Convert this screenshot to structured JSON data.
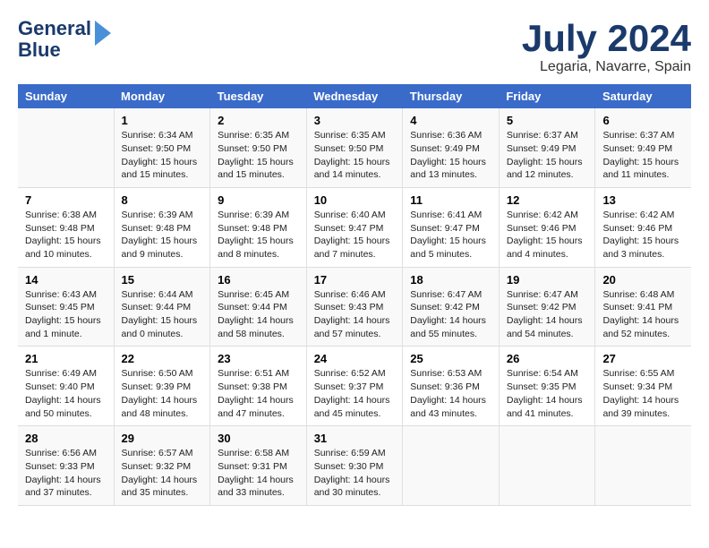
{
  "header": {
    "logo_line1": "General",
    "logo_line2": "Blue",
    "title": "July 2024",
    "subtitle": "Legaria, Navarre, Spain"
  },
  "days_of_week": [
    "Sunday",
    "Monday",
    "Tuesday",
    "Wednesday",
    "Thursday",
    "Friday",
    "Saturday"
  ],
  "weeks": [
    [
      {
        "day": "",
        "content": ""
      },
      {
        "day": "1",
        "content": "Sunrise: 6:34 AM\nSunset: 9:50 PM\nDaylight: 15 hours\nand 15 minutes."
      },
      {
        "day": "2",
        "content": "Sunrise: 6:35 AM\nSunset: 9:50 PM\nDaylight: 15 hours\nand 15 minutes."
      },
      {
        "day": "3",
        "content": "Sunrise: 6:35 AM\nSunset: 9:50 PM\nDaylight: 15 hours\nand 14 minutes."
      },
      {
        "day": "4",
        "content": "Sunrise: 6:36 AM\nSunset: 9:49 PM\nDaylight: 15 hours\nand 13 minutes."
      },
      {
        "day": "5",
        "content": "Sunrise: 6:37 AM\nSunset: 9:49 PM\nDaylight: 15 hours\nand 12 minutes."
      },
      {
        "day": "6",
        "content": "Sunrise: 6:37 AM\nSunset: 9:49 PM\nDaylight: 15 hours\nand 11 minutes."
      }
    ],
    [
      {
        "day": "7",
        "content": "Sunrise: 6:38 AM\nSunset: 9:48 PM\nDaylight: 15 hours\nand 10 minutes."
      },
      {
        "day": "8",
        "content": "Sunrise: 6:39 AM\nSunset: 9:48 PM\nDaylight: 15 hours\nand 9 minutes."
      },
      {
        "day": "9",
        "content": "Sunrise: 6:39 AM\nSunset: 9:48 PM\nDaylight: 15 hours\nand 8 minutes."
      },
      {
        "day": "10",
        "content": "Sunrise: 6:40 AM\nSunset: 9:47 PM\nDaylight: 15 hours\nand 7 minutes."
      },
      {
        "day": "11",
        "content": "Sunrise: 6:41 AM\nSunset: 9:47 PM\nDaylight: 15 hours\nand 5 minutes."
      },
      {
        "day": "12",
        "content": "Sunrise: 6:42 AM\nSunset: 9:46 PM\nDaylight: 15 hours\nand 4 minutes."
      },
      {
        "day": "13",
        "content": "Sunrise: 6:42 AM\nSunset: 9:46 PM\nDaylight: 15 hours\nand 3 minutes."
      }
    ],
    [
      {
        "day": "14",
        "content": "Sunrise: 6:43 AM\nSunset: 9:45 PM\nDaylight: 15 hours\nand 1 minute."
      },
      {
        "day": "15",
        "content": "Sunrise: 6:44 AM\nSunset: 9:44 PM\nDaylight: 15 hours\nand 0 minutes."
      },
      {
        "day": "16",
        "content": "Sunrise: 6:45 AM\nSunset: 9:44 PM\nDaylight: 14 hours\nand 58 minutes."
      },
      {
        "day": "17",
        "content": "Sunrise: 6:46 AM\nSunset: 9:43 PM\nDaylight: 14 hours\nand 57 minutes."
      },
      {
        "day": "18",
        "content": "Sunrise: 6:47 AM\nSunset: 9:42 PM\nDaylight: 14 hours\nand 55 minutes."
      },
      {
        "day": "19",
        "content": "Sunrise: 6:47 AM\nSunset: 9:42 PM\nDaylight: 14 hours\nand 54 minutes."
      },
      {
        "day": "20",
        "content": "Sunrise: 6:48 AM\nSunset: 9:41 PM\nDaylight: 14 hours\nand 52 minutes."
      }
    ],
    [
      {
        "day": "21",
        "content": "Sunrise: 6:49 AM\nSunset: 9:40 PM\nDaylight: 14 hours\nand 50 minutes."
      },
      {
        "day": "22",
        "content": "Sunrise: 6:50 AM\nSunset: 9:39 PM\nDaylight: 14 hours\nand 48 minutes."
      },
      {
        "day": "23",
        "content": "Sunrise: 6:51 AM\nSunset: 9:38 PM\nDaylight: 14 hours\nand 47 minutes."
      },
      {
        "day": "24",
        "content": "Sunrise: 6:52 AM\nSunset: 9:37 PM\nDaylight: 14 hours\nand 45 minutes."
      },
      {
        "day": "25",
        "content": "Sunrise: 6:53 AM\nSunset: 9:36 PM\nDaylight: 14 hours\nand 43 minutes."
      },
      {
        "day": "26",
        "content": "Sunrise: 6:54 AM\nSunset: 9:35 PM\nDaylight: 14 hours\nand 41 minutes."
      },
      {
        "day": "27",
        "content": "Sunrise: 6:55 AM\nSunset: 9:34 PM\nDaylight: 14 hours\nand 39 minutes."
      }
    ],
    [
      {
        "day": "28",
        "content": "Sunrise: 6:56 AM\nSunset: 9:33 PM\nDaylight: 14 hours\nand 37 minutes."
      },
      {
        "day": "29",
        "content": "Sunrise: 6:57 AM\nSunset: 9:32 PM\nDaylight: 14 hours\nand 35 minutes."
      },
      {
        "day": "30",
        "content": "Sunrise: 6:58 AM\nSunset: 9:31 PM\nDaylight: 14 hours\nand 33 minutes."
      },
      {
        "day": "31",
        "content": "Sunrise: 6:59 AM\nSunset: 9:30 PM\nDaylight: 14 hours\nand 30 minutes."
      },
      {
        "day": "",
        "content": ""
      },
      {
        "day": "",
        "content": ""
      },
      {
        "day": "",
        "content": ""
      }
    ]
  ]
}
